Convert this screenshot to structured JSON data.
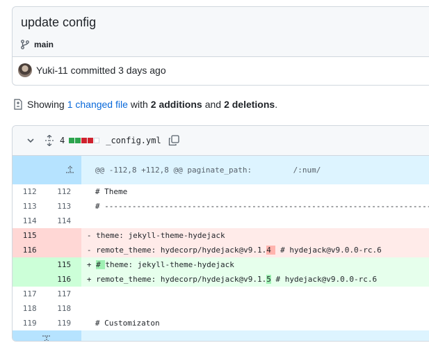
{
  "commit": {
    "title": "update config",
    "branch": "main",
    "author": "Yuki-11",
    "meta": "committed 3 days ago"
  },
  "summary": {
    "showing": "Showing",
    "changed_link": "1 changed file",
    "with": "with",
    "additions": "2 additions",
    "and": "and",
    "deletions": "2 deletions",
    "period": "."
  },
  "file": {
    "change_count": "4",
    "name": "_config.yml",
    "colors": {
      "add": "#2da44e",
      "del": "#cf222e",
      "neutral": "#d0d7de"
    }
  },
  "diff": {
    "hunk_header": "@@ -112,8 +112,8 @@ paginate_path:         /:num/",
    "lines": [
      {
        "type": "ctx",
        "old": "112",
        "new": "112",
        "text": "# Theme"
      },
      {
        "type": "ctx",
        "old": "113",
        "new": "113",
        "text": "# -----------------------------------------------------------------------"
      },
      {
        "type": "ctx",
        "old": "114",
        "new": "114",
        "text": ""
      },
      {
        "type": "del",
        "old": "115",
        "new": "",
        "sign": "-",
        "text": "theme: jekyll-theme-hydejack"
      },
      {
        "type": "del",
        "old": "116",
        "new": "",
        "sign": "-",
        "pre": "remote_theme: hydecorp/hydejack@v9.1.",
        "hl": "4 ",
        "post": " # hydejack@v9.0.0-rc.6"
      },
      {
        "type": "add",
        "old": "",
        "new": "115",
        "sign": "+",
        "pre": "",
        "hl": "# ",
        "post": "theme: jekyll-theme-hydejack"
      },
      {
        "type": "add",
        "old": "",
        "new": "116",
        "sign": "+",
        "pre": "remote_theme: hydecorp/hydejack@v9.1.",
        "hl": "5",
        "post": " # hydejack@v9.0.0-rc.6"
      },
      {
        "type": "ctx",
        "old": "117",
        "new": "117",
        "text": ""
      },
      {
        "type": "ctx",
        "old": "118",
        "new": "118",
        "text": ""
      },
      {
        "type": "ctx",
        "old": "119",
        "new": "119",
        "text": "# Customizaton"
      }
    ]
  }
}
